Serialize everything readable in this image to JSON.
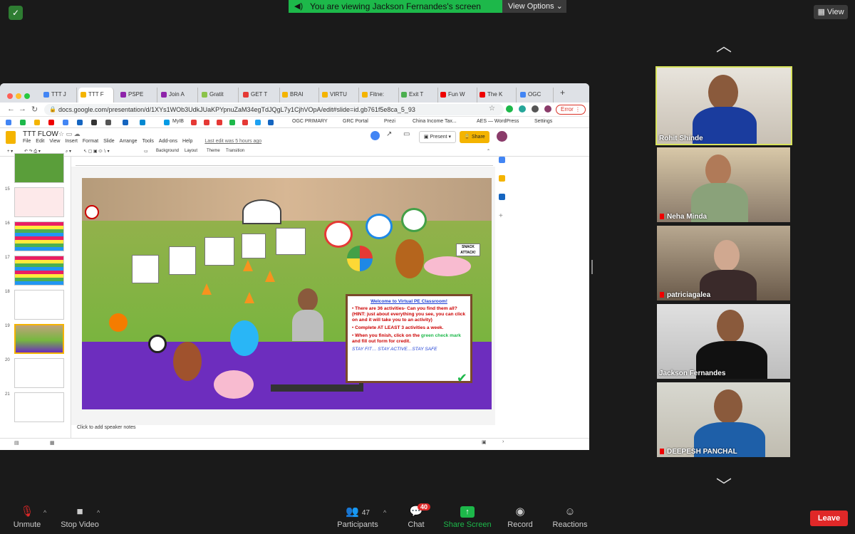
{
  "zoom": {
    "banner": "You are viewing Jackson Fernandes's screen",
    "view_options": "View Options",
    "view_label": "View",
    "leave": "Leave",
    "controls": [
      {
        "label": "Unmute",
        "icon": "mic-muted-icon"
      },
      {
        "label": "Stop Video",
        "icon": "video-icon"
      },
      {
        "label": "Participants",
        "icon": "participants-icon",
        "count": "47"
      },
      {
        "label": "Chat",
        "icon": "chat-icon",
        "badge": "40"
      },
      {
        "label": "Share Screen",
        "icon": "share-screen-icon"
      },
      {
        "label": "Record",
        "icon": "record-icon"
      },
      {
        "label": "Reactions",
        "icon": "reactions-icon"
      }
    ],
    "participants": [
      {
        "name": "Rohit Shinde",
        "active": true,
        "muted": false
      },
      {
        "name": "Neha Minda",
        "active": false,
        "muted": true
      },
      {
        "name": "patriciagalea",
        "active": false,
        "muted": true
      },
      {
        "name": "Jackson Fernandes",
        "active": false,
        "muted": false
      },
      {
        "name": "DEEPESH PANCHAL",
        "active": false,
        "muted": true
      }
    ]
  },
  "browser": {
    "tabs": [
      "TTT J",
      "TTT F",
      "PSPE",
      "Join A",
      "Gratit",
      "GET T",
      "BRAI",
      "VIRTU",
      "Fitne:",
      "Exit T",
      "Fun W",
      "The K",
      "OGC"
    ],
    "url": "docs.google.com/presentation/d/1XYs1WOb3UdkJUaKPYpnuZaM34egTdJQgL7y1CjhVOpA/edit#slide=id.gb761f5e8ca_5_93",
    "error_label": "Error",
    "bookmarks": [
      "MyIB",
      "OGC PRIMARY",
      "GRC Portal",
      "Prezi",
      "China Income Tax...",
      "AES — WordPress",
      "Settings"
    ]
  },
  "slides": {
    "title": "TTT FLOW",
    "menu": [
      "File",
      "Edit",
      "View",
      "Insert",
      "Format",
      "Slide",
      "Arrange",
      "Tools",
      "Add-ons",
      "Help"
    ],
    "last_edit": "Last edit was 5 hours ago",
    "present": "Present",
    "share": "Share",
    "toolbar": [
      "Background",
      "Layout",
      "Theme",
      "Transition"
    ],
    "thumb_numbers": [
      "15",
      "16",
      "17",
      "18",
      "19",
      "20",
      "21"
    ],
    "speaker_notes": "Click to add speaker notes",
    "slide": {
      "heading": "Welcome to Virtual PE Classroom!",
      "bullet1": "There are 36 activities- Can you find them all? (HINT: just about everything you see, you can click on and it will take you to an activity)",
      "bullet2": "Complete AT LEAST 3 activities a week.",
      "bullet3a": "When you finish, click on the",
      "bullet3b": "green check mark",
      "bullet3c": "and fill out form for credit.",
      "motto": "STAY FIT… STAY ACTIVE…STAY SAFE",
      "snack": "SNACK ATTACK!"
    }
  }
}
